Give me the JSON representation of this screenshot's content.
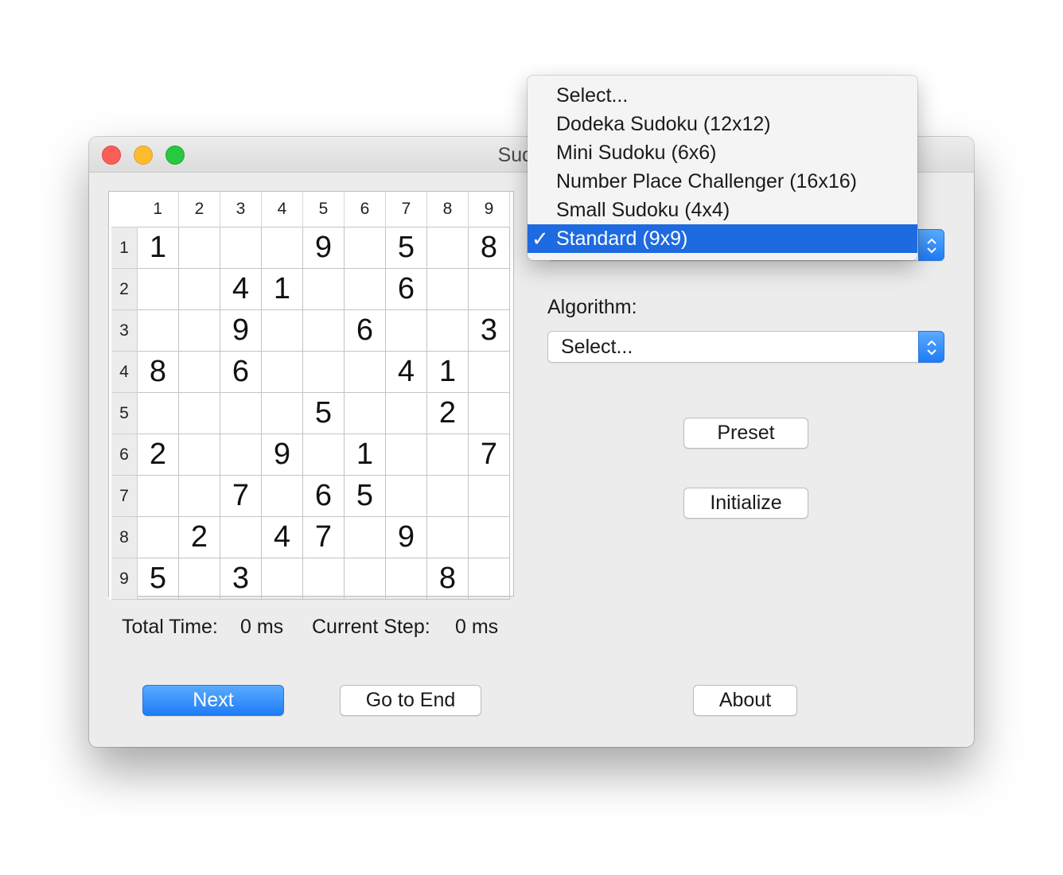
{
  "window": {
    "title": "Sudoku"
  },
  "grid": {
    "column_headers": [
      "1",
      "2",
      "3",
      "4",
      "5",
      "6",
      "7",
      "8",
      "9"
    ],
    "row_headers": [
      "1",
      "2",
      "3",
      "4",
      "5",
      "6",
      "7",
      "8",
      "9"
    ],
    "cells": [
      [
        "1",
        "",
        "",
        "",
        "9",
        "",
        "5",
        "",
        "8"
      ],
      [
        "",
        "",
        "4",
        "1",
        "",
        "",
        "6",
        "",
        ""
      ],
      [
        "",
        "",
        "9",
        "",
        "",
        "6",
        "",
        "",
        "3"
      ],
      [
        "8",
        "",
        "6",
        "",
        "",
        "",
        "4",
        "1",
        ""
      ],
      [
        "",
        "",
        "",
        "",
        "5",
        "",
        "",
        "2",
        ""
      ],
      [
        "2",
        "",
        "",
        "9",
        "",
        "1",
        "",
        "",
        "7"
      ],
      [
        "",
        "",
        "7",
        "",
        "6",
        "5",
        "",
        "",
        ""
      ],
      [
        "",
        "2",
        "",
        "4",
        "7",
        "",
        "9",
        "",
        ""
      ],
      [
        "5",
        "",
        "3",
        "",
        "",
        "",
        "",
        "8",
        ""
      ]
    ]
  },
  "status": {
    "total_time_label": "Total Time:",
    "total_time_value": "0 ms",
    "current_step_label": "Current Step:",
    "current_step_value": "0 ms"
  },
  "algorithm": {
    "label": "Algorithm:",
    "selected": "Select..."
  },
  "buttons": {
    "preset": "Preset",
    "initialize": "Initialize",
    "next": "Next",
    "go_to_end": "Go to End",
    "about": "About"
  },
  "puzzle_menu": {
    "items": [
      "Select...",
      "Dodeka Sudoku (12x12)",
      "Mini Sudoku (6x6)",
      "Number Place Challenger (16x16)",
      "Small Sudoku (4x4)",
      "Standard (9x9)"
    ],
    "selected_index": 5,
    "check_mark": "✓"
  },
  "colors": {
    "accent": "#1e6ae0",
    "window_bg": "#ececec"
  }
}
